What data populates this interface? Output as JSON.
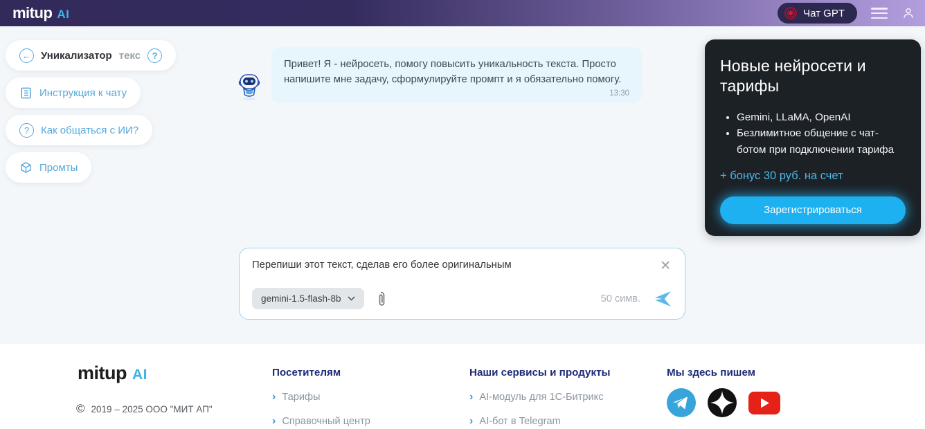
{
  "navbar": {
    "logo_brand": "mitup",
    "logo_suffix": "AI",
    "chat_gpt_label": "Чат GPT"
  },
  "sidebar": {
    "unikalizator_main": "Уникализатор",
    "unikalizator_trunc": "текс",
    "items": [
      {
        "label": "Инструкция к чату"
      },
      {
        "label": "Как общаться с ИИ?"
      },
      {
        "label": "Промты"
      }
    ]
  },
  "chat": {
    "message": "Привет! Я - нейросеть, помогу повысить уникальность текста. Просто напишите мне задачу, сформулируйте промпт и я обязательно помогу.",
    "time": "13:30"
  },
  "composer": {
    "value": "Перепиши этот текст, сделав его более оригинальным",
    "model": "gemini-1.5-flash-8b",
    "char_count": "50 симв.",
    "close_glyph": "✕"
  },
  "promo": {
    "title": "Новые нейросети и тарифы",
    "bullets": [
      "Gemini, LLaMA, OpenAI",
      "Безлимитное общение с чат-ботом при подключении тарифа"
    ],
    "bonus_link": "+ бонус 30 руб. на счет",
    "register_label": "Зарегистрироваться"
  },
  "footer": {
    "logo_brand": "mitup",
    "logo_suffix": "AI",
    "copyright": "2019 – 2025 ООО \"МИТ АП\"",
    "columns": [
      {
        "heading": "Посетителям",
        "links": [
          "Тарифы",
          "Справочный центр"
        ]
      },
      {
        "heading": "Наши сервисы и продукты",
        "links": [
          "AI-модуль для 1С-Битрикс",
          "AI-бот в Telegram"
        ]
      }
    ],
    "social_heading": "Мы здесь пишем",
    "social_icons": [
      "telegram",
      "dzen",
      "youtube"
    ]
  },
  "colors": {
    "accent_blue": "#1db1f2",
    "link_blue": "#49b7e8",
    "sidebar_blue": "#54a9dc",
    "navbar_dark": "#332a5c",
    "navbar_light": "#b29ddd",
    "promo_bg": "#1c2126",
    "youtube_red": "#e62117",
    "telegram_blue": "#37a5dc"
  }
}
